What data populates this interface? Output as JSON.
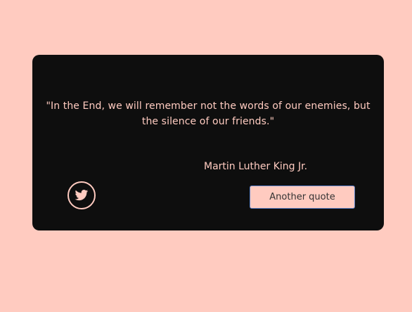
{
  "quote": {
    "text": "\"In the End, we will remember not the words of our enemies, but the silence of our friends.\"",
    "author": "Martin Luther King Jr."
  },
  "actions": {
    "tweet_icon": "twitter-icon",
    "another_quote_label": "Another quote"
  },
  "colors": {
    "background": "#ffcbc0",
    "card": "#0e0e0e",
    "accent_text": "#ffcbc0",
    "button_border": "#5a7fc4"
  }
}
